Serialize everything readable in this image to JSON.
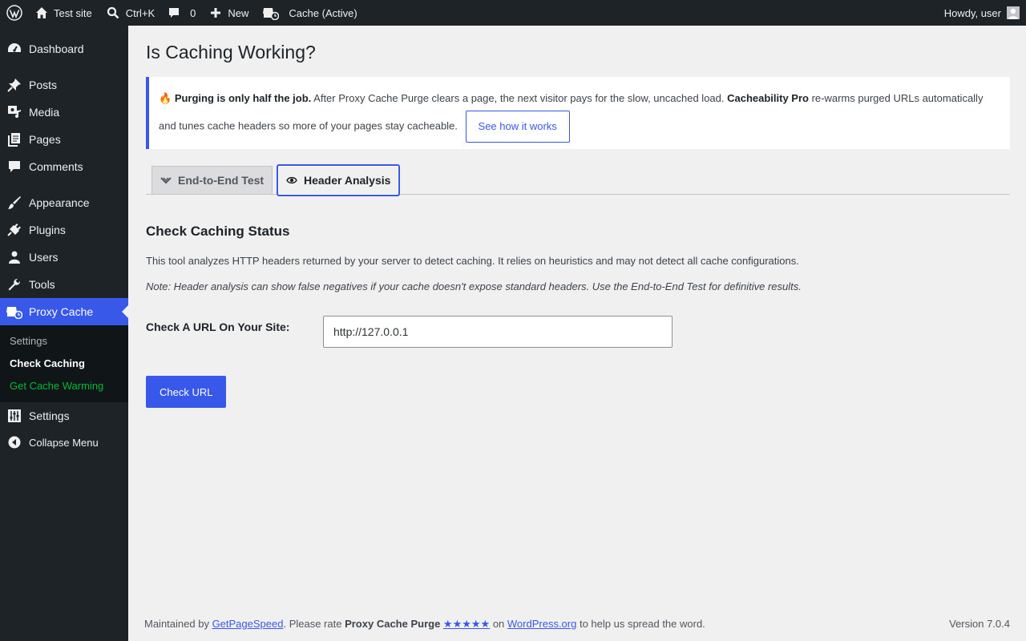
{
  "adminbar": {
    "site_name": "Test site",
    "search_shortcut": "Ctrl+K",
    "comments_count": "0",
    "new_label": "New",
    "cache_status": "Cache (Active)",
    "howdy": "Howdy, user"
  },
  "sidebar": {
    "items": [
      {
        "label": "Dashboard",
        "icon": "dashboard-icon"
      },
      {
        "label": "Posts",
        "icon": "pin-icon"
      },
      {
        "label": "Media",
        "icon": "media-icon"
      },
      {
        "label": "Pages",
        "icon": "pages-icon"
      },
      {
        "label": "Comments",
        "icon": "comment-icon"
      },
      {
        "label": "Appearance",
        "icon": "brush-icon"
      },
      {
        "label": "Plugins",
        "icon": "plug-icon"
      },
      {
        "label": "Users",
        "icon": "user-icon"
      },
      {
        "label": "Tools",
        "icon": "wrench-icon"
      },
      {
        "label": "Proxy Cache",
        "icon": "proxy-cache-icon"
      },
      {
        "label": "Settings",
        "icon": "settings-icon"
      }
    ],
    "submenu": [
      {
        "label": "Settings"
      },
      {
        "label": "Check Caching"
      },
      {
        "label": "Get Cache Warming"
      }
    ],
    "collapse_label": "Collapse Menu"
  },
  "page": {
    "title": "Is Caching Working?",
    "notice": {
      "emoji": "🔥",
      "lead": "Purging is only half the job.",
      "text1": " After Proxy Cache Purge clears a page, the next visitor pays for the slow, uncached load. ",
      "product": "Cacheability Pro",
      "text2": " re-warms purged URLs automatically and tunes cache headers so more of your pages stay cacheable.",
      "button": "See how it works"
    },
    "tabs": [
      {
        "label": "End-to-End Test",
        "active": false
      },
      {
        "label": "Header Analysis",
        "active": true
      }
    ],
    "section_title": "Check Caching Status",
    "description": "This tool analyzes HTTP headers returned by your server to detect caching. It relies on heuristics and may not detect all cache configurations.",
    "note": "Note: Header analysis can show false negatives if your cache doesn't expose standard headers. Use the End-to-End Test for definitive results.",
    "url_label": "Check A URL On Your Site:",
    "url_value": "http://127.0.0.1",
    "check_button": "Check URL"
  },
  "footer": {
    "maintained_by": "Maintained by ",
    "link1": "GetPageSpeed",
    "rate_text": ". Please rate ",
    "plugin_name": "Proxy Cache Purge",
    "stars": "★★★★★",
    "on": " on ",
    "link2": "WordPress.org",
    "tail": " to help us spread the word.",
    "version": "Version 7.0.4"
  },
  "colors": {
    "accent": "#3858e9",
    "adminbar_bg": "#1d2327",
    "submenu_highlight": "#00ba37"
  }
}
